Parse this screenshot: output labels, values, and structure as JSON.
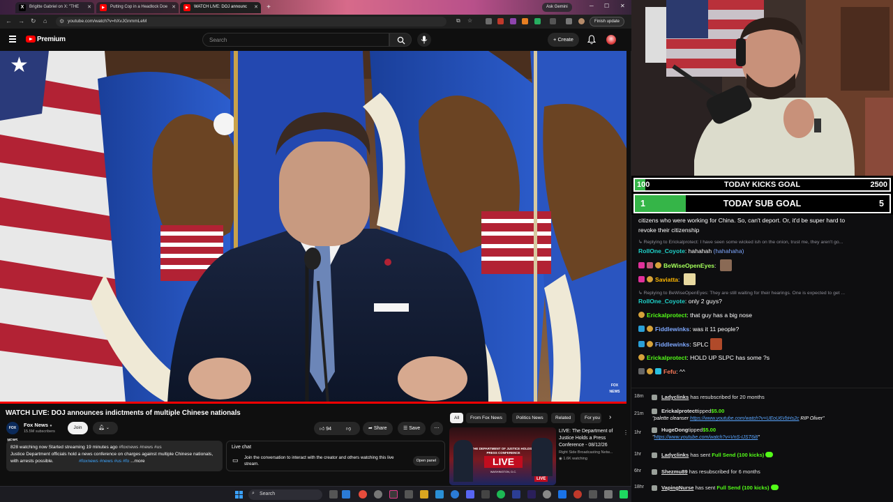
{
  "browser": {
    "tabs": [
      {
        "label": "Brigitte Gabriel on X: \"THE",
        "favicon": "X",
        "color": "#000000"
      },
      {
        "label": "Putting Cop in a Headlock Doe",
        "favicon": "▶",
        "color": "#ff0000"
      },
      {
        "label": "WATCH LIVE: DOJ announc",
        "favicon": "▶",
        "color": "#ff0000"
      }
    ],
    "ask_gemini": "Ask Gemini",
    "url": "youtube.com/watch?v=hXvJGnmmLeM",
    "finish_update": "Finish update"
  },
  "youtube": {
    "brand": "Premium",
    "search_placeholder": "Search",
    "create_label": "+ Create",
    "video_title": "WATCH LIVE: DOJ announces indictments of multiple Chinese nationals",
    "channel": {
      "name": "Fox News",
      "subscribers": "15.5M subscribers",
      "avatar_text": "FOX NEWS",
      "join": "Join"
    },
    "actions": {
      "likes": "94",
      "share": "Share",
      "save": "Save"
    },
    "description": {
      "stats": "828 watching now  Started streaming 19 minutes ago",
      "tags": "#foxnews #news #us",
      "text": "Justice Department officials hold a news conference on charges against multiple Chinese nationals, with arrests possible.",
      "tags2": "#foxnews #news #us #fo",
      "more": "...more"
    },
    "live_chat": {
      "title": "Live chat",
      "text": "Join the conversation to interact with the creator and others watching this live stream.",
      "open_panel": "Open panel"
    },
    "chips": [
      "All",
      "From Fox News",
      "Politics News",
      "Related",
      "For you"
    ],
    "related": {
      "title": "LIVE: The Department of Justice Holds a Press Conference - 08/12/26",
      "channel": "Right Side Broadcasting Netw...",
      "watching": "1.6K watching",
      "thumb_banner": "THE DEPARTMENT OF JUSTICE HOLDS A PRESS CONFERENCE",
      "thumb_live": "LIVE",
      "thumb_loc": "WASHINGTON, D.C.",
      "thumb_badge": "LIVE"
    },
    "video_watermark": "FOX NEWS"
  },
  "taskbar": {
    "search": "Search"
  },
  "stream": {
    "goals": {
      "kicks": {
        "current": "100",
        "label": "TODAY KICKS GOAL",
        "target": "2500",
        "progress": 0.04
      },
      "subs": {
        "current": "1",
        "label": "TODAY SUB GOAL",
        "target": "5",
        "progress": 0.2
      }
    },
    "chat": [
      {
        "type": "text",
        "text": "citizens who were working for China. So, can't deport. Or, it'd be super hard to"
      },
      {
        "type": "text",
        "text": "revoke their citizenship"
      },
      {
        "type": "reply",
        "text": "↳ Replying to Erickalprotect: I have seen some wicked ish on the onion, trust me, they aren't go..."
      },
      {
        "type": "msg",
        "user": "RollOne_Coyote",
        "color": "#1fd1c9",
        "text": "hahahah",
        "extra": "(hahahaha)"
      },
      {
        "type": "msg",
        "user": "BeWiseOpenEyes",
        "color": "#a4ff5a",
        "text": ""
      },
      {
        "type": "msg",
        "user": "Saviatta",
        "color": "#ffb800",
        "text": ""
      },
      {
        "type": "reply",
        "text": "↳ Replying to BeWiseOpenEyes: They are still waiting for their hearings. One is expected to get ..."
      },
      {
        "type": "msg",
        "user": "RollOne_Coyote",
        "color": "#1fd1c9",
        "text": "only 2 guys?"
      },
      {
        "type": "msg",
        "user": "Erickalprotect",
        "color": "#53fc18",
        "text": "that guy has a big nose"
      },
      {
        "type": "msg",
        "user": "Fiddlewinks",
        "color": "#7ea8ff",
        "text": "was it 11 people?"
      },
      {
        "type": "msg",
        "user": "Fiddlewinks",
        "color": "#7ea8ff",
        "text": "SPLC"
      },
      {
        "type": "msg",
        "user": "Erickalprotect",
        "color": "#53fc18",
        "text": "HOLD UP SLPC has some ?s"
      },
      {
        "type": "msg",
        "user": "Fefu",
        "color": "#ff7a59",
        "text": "^^"
      }
    ],
    "events": [
      {
        "time": "18m",
        "user": "Ladyclinks",
        "text": " has resubscribed for 20 months"
      },
      {
        "time": "21m",
        "user": "Erickalprotect",
        "text": "tipped",
        "amount": "$5.00",
        "quote_link": "https://www.youtube.com/watch?v=UEoU6VbHs2c",
        "quote_text": " RIP Oliver\""
      },
      {
        "time": "1hr",
        "user": "HugeDong",
        "text": "tipped",
        "amount": "$5.00",
        "quote_link": "https://www.youtube.com/watch?v=VnS-IJST6i8"
      },
      {
        "time": "1hr",
        "user": "Ladyclinks",
        "text": " has sent ",
        "gift": "Full Send (100 kicks)"
      },
      {
        "time": "6hr",
        "user": "Shezmu89",
        "text": " has resubscribed for 6 months"
      },
      {
        "time": "18hr",
        "user": "VapingNurse",
        "text": " has sent ",
        "gift": "Full Send (100 kicks)"
      }
    ]
  }
}
